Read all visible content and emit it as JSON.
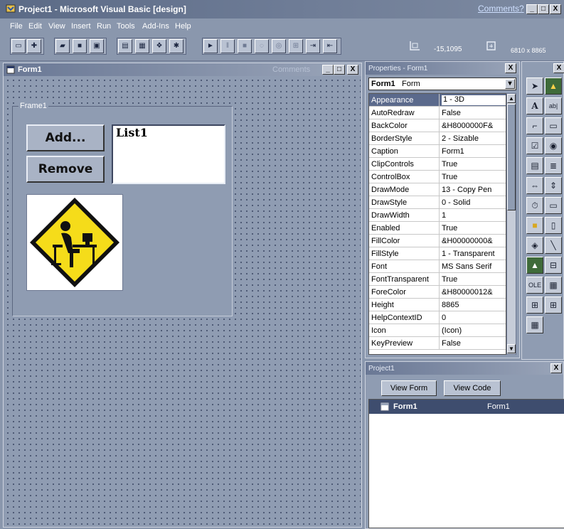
{
  "titlebar": {
    "title": "Project1 - Microsoft Visual Basic [design]",
    "comments_link": "Comments?",
    "buttons": [
      "_",
      "□",
      "X"
    ]
  },
  "menu": [
    "File",
    "Edit",
    "View",
    "Insert",
    "Run",
    "Tools",
    "Add-Ins",
    "Help"
  ],
  "toolbar": {
    "position": "-15,1095",
    "size": "6810 x 8865",
    "icons": [
      "add-project-icon",
      "add-form-icon",
      "open-icon",
      "save-icon",
      "lock-icon",
      "menu-editor-icon",
      "properties-icon",
      "project-explorer-icon",
      "object-browser-icon",
      "run-icon",
      "pause-icon",
      "stop-icon",
      "toggle-breakpoint-icon",
      "instant-watch-icon",
      "calls-icon",
      "step-into-icon",
      "step-over-icon"
    ]
  },
  "form_window": {
    "title": "Form1",
    "watermark": "Comments",
    "frame_label": "Frame1",
    "add_button": "Add...",
    "remove_button": "Remove",
    "list_text": "List1",
    "picture": "warning-person-at-computer-icon"
  },
  "properties": {
    "title": "Properties - Form1",
    "object_name": "Form1",
    "object_type": "Form",
    "rows": [
      {
        "name": "Appearance",
        "value": "1 - 3D"
      },
      {
        "name": "AutoRedraw",
        "value": "False"
      },
      {
        "name": "BackColor",
        "value": "&H8000000F&"
      },
      {
        "name": "BorderStyle",
        "value": "2 - Sizable"
      },
      {
        "name": "Caption",
        "value": "Form1"
      },
      {
        "name": "ClipControls",
        "value": "True"
      },
      {
        "name": "ControlBox",
        "value": "True"
      },
      {
        "name": "DrawMode",
        "value": "13 - Copy Pen"
      },
      {
        "name": "DrawStyle",
        "value": "0 - Solid"
      },
      {
        "name": "DrawWidth",
        "value": "1"
      },
      {
        "name": "Enabled",
        "value": "True"
      },
      {
        "name": "FillColor",
        "value": "&H00000000&"
      },
      {
        "name": "FillStyle",
        "value": "1 - Transparent"
      },
      {
        "name": "Font",
        "value": "MS Sans Serif"
      },
      {
        "name": "FontTransparent",
        "value": "True"
      },
      {
        "name": "ForeColor",
        "value": "&H80000012&"
      },
      {
        "name": "Height",
        "value": "8865"
      },
      {
        "name": "HelpContextID",
        "value": "0"
      },
      {
        "name": "Icon",
        "value": "(Icon)"
      },
      {
        "name": "KeyPreview",
        "value": "False"
      }
    ]
  },
  "project": {
    "title": "Project1",
    "view_form": "View Form",
    "view_code": "View Code",
    "item_name": "Form1",
    "item_file": "Form1"
  },
  "toolbox": {
    "tools": [
      "pointer-icon",
      "picturebox-icon",
      "label-icon",
      "textbox-icon",
      "frame-icon",
      "commandbutton-icon",
      "checkbox-icon",
      "optionbutton-icon",
      "combobox-icon",
      "listbox-icon",
      "hscrollbar-icon",
      "vscrollbar-icon",
      "timer-icon",
      "drivelistbox-icon",
      "dirlistbox-icon",
      "filelistbox-icon",
      "shape-icon",
      "line-icon",
      "image-icon",
      "data-icon",
      "ole-icon",
      "grid-icon",
      "custom1-icon",
      "custom2-icon",
      "custom3-icon"
    ]
  },
  "colors": {
    "background": "#8a97ad",
    "titlebar": "#5b6a86",
    "selection": "#5b6a8c",
    "sign_yellow": "#f5dc1a"
  }
}
